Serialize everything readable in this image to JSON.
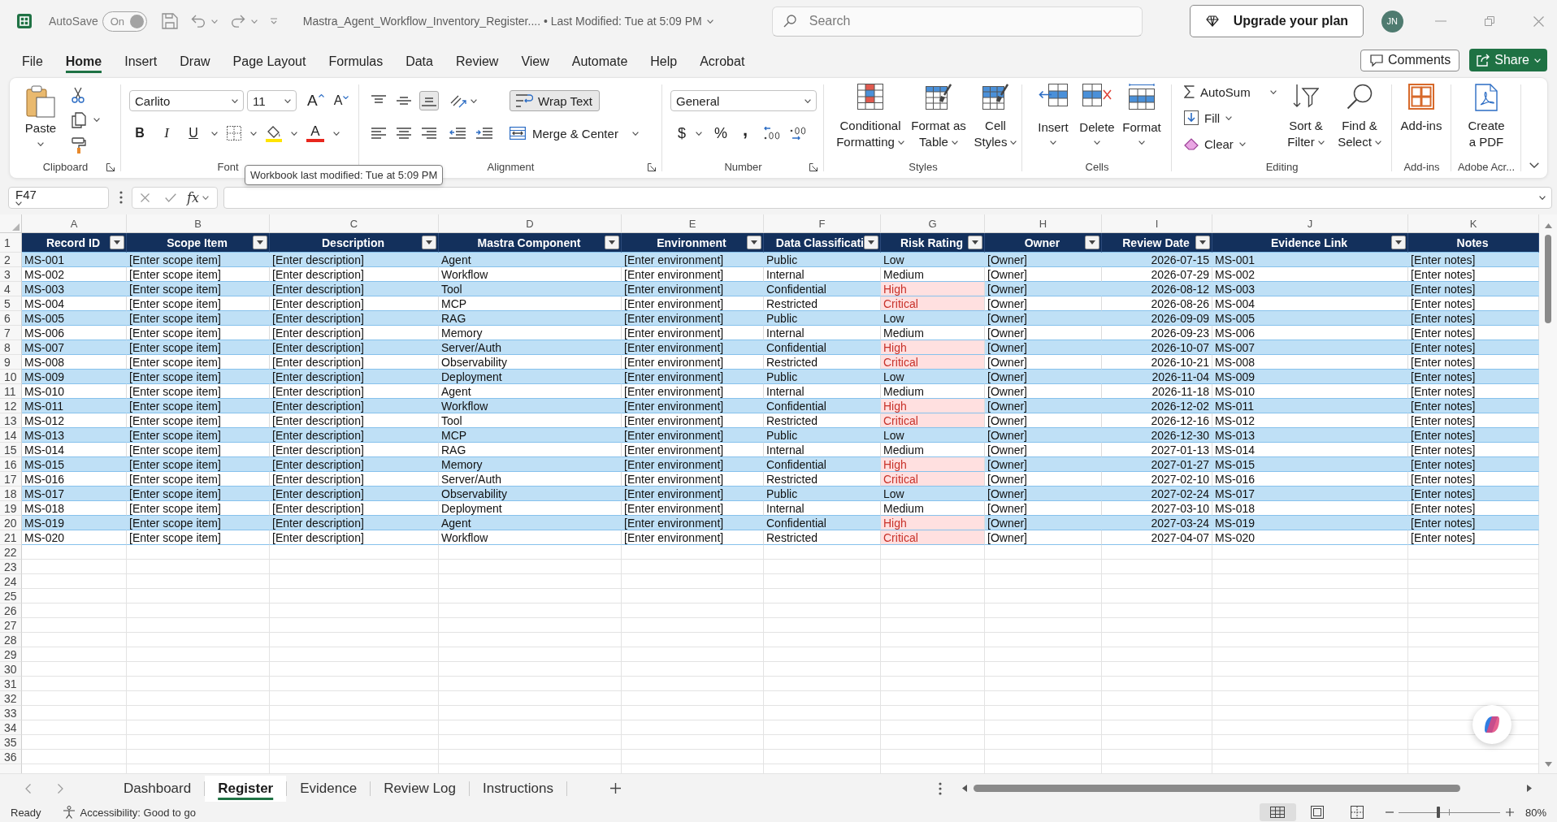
{
  "title_bar": {
    "autosave": {
      "label": "AutoSave",
      "state": "On",
      "on": true,
      "disabled": true
    },
    "title": "Mastra_Agent_Workflow_Inventory_Register.... • Last Modified: Tue at 5:09 PM",
    "search": {
      "placeholder": "Search"
    },
    "upgrade_button": "Upgrade your plan",
    "avatar": "JN"
  },
  "menu": {
    "tabs": [
      {
        "label": "File",
        "selected": false
      },
      {
        "label": "Home",
        "selected": true
      },
      {
        "label": "Insert",
        "selected": false
      },
      {
        "label": "Draw",
        "selected": false
      },
      {
        "label": "Page Layout",
        "selected": false
      },
      {
        "label": "Formulas",
        "selected": false
      },
      {
        "label": "Data",
        "selected": false
      },
      {
        "label": "Review",
        "selected": false
      },
      {
        "label": "View",
        "selected": false
      },
      {
        "label": "Automate",
        "selected": false
      },
      {
        "label": "Help",
        "selected": false
      },
      {
        "label": "Acrobat",
        "selected": false
      }
    ],
    "comments_button": "Comments",
    "share_button": "Share"
  },
  "ribbon": {
    "clipboard": {
      "label": "Clipboard",
      "paste": "Paste"
    },
    "font": {
      "label": "Font",
      "font_name": "Carlito",
      "font_size": "11",
      "grow_font": "A",
      "shrink_font": "A",
      "bold": "B",
      "italic": "I",
      "underline": "U",
      "font_color": "A"
    },
    "alignment": {
      "label": "Alignment",
      "vertical_align": [
        {
          "selected": false
        },
        {
          "selected": false
        },
        {
          "selected": true
        }
      ],
      "wrap_text": {
        "label": "Wrap Text",
        "selected": true
      },
      "merge": "Merge & Center"
    },
    "number": {
      "label": "Number",
      "format": "General",
      "currency": "$",
      "percent": "%",
      "comma": ","
    },
    "styles": {
      "label": "Styles",
      "buttons": [
        "Conditional Formatting",
        "Format as Table",
        "Cell Styles"
      ]
    },
    "cells": {
      "label": "Cells",
      "buttons": [
        "Insert",
        "Delete",
        "Format"
      ]
    },
    "editing": {
      "label": "Editing",
      "autosum": "AutoSum",
      "fill": "Fill",
      "clear": "Clear",
      "sort_filter": "Sort & Filter",
      "find_select": "Find & Select"
    },
    "add_ins": {
      "label": "Add-ins",
      "button": "Add-ins"
    },
    "acrobat": {
      "label": "Adobe Acr...",
      "button": "Create a PDF"
    }
  },
  "tooltip": "Workbook last modified: Tue at 5:09 PM",
  "formula_bar": {
    "name_box": "F47",
    "function_button": "fx"
  },
  "sheet": {
    "column_letters": [
      "A",
      "B",
      "C",
      "D",
      "E",
      "F",
      "G",
      "H",
      "I",
      "J",
      "K"
    ],
    "row_numbers": [
      "1",
      "2",
      "3",
      "4",
      "5",
      "6",
      "7",
      "8",
      "9",
      "10",
      "11",
      "12",
      "13",
      "14",
      "15",
      "16",
      "17",
      "18",
      "19",
      "20",
      "21",
      "22",
      "23",
      "24",
      "25",
      "26",
      "27",
      "28",
      "29",
      "30",
      "31",
      "32",
      "33",
      "34",
      "35",
      "36"
    ],
    "columns": [
      {
        "label": "Record ID",
        "filter": true,
        "kind": "text"
      },
      {
        "label": "Scope Item",
        "filter": true,
        "kind": "text"
      },
      {
        "label": "Description",
        "filter": true,
        "kind": "text"
      },
      {
        "label": "Mastra Component",
        "filter": true,
        "kind": "text"
      },
      {
        "label": "Environment",
        "filter": true,
        "kind": "text"
      },
      {
        "label": "Data Classificati",
        "filter": true,
        "kind": "text"
      },
      {
        "label": "Risk Rating",
        "filter": true,
        "kind": "rating"
      },
      {
        "label": "Owner",
        "filter": true,
        "kind": "text"
      },
      {
        "label": "Review Date",
        "filter": true,
        "kind": "date"
      },
      {
        "label": "Evidence Link",
        "filter": true,
        "kind": "text"
      },
      {
        "label": "Notes",
        "filter": false,
        "kind": "text"
      }
    ],
    "rows": [
      {
        "cells": [
          "MS-001",
          "[Enter scope item]",
          "[Enter description]",
          "Agent",
          "[Enter environment]",
          "Public",
          "Low",
          "[Owner]",
          "2026-07-15",
          "MS-001",
          "[Enter notes]"
        ],
        "flagged": false
      },
      {
        "cells": [
          "MS-002",
          "[Enter scope item]",
          "[Enter description]",
          "Workflow",
          "[Enter environment]",
          "Internal",
          "Medium",
          "[Owner]",
          "2026-07-29",
          "MS-002",
          "[Enter notes]"
        ],
        "flagged": false
      },
      {
        "cells": [
          "MS-003",
          "[Enter scope item]",
          "[Enter description]",
          "Tool",
          "[Enter environment]",
          "Confidential",
          "High",
          "[Owner]",
          "2026-08-12",
          "MS-003",
          "[Enter notes]"
        ],
        "flagged": true
      },
      {
        "cells": [
          "MS-004",
          "[Enter scope item]",
          "[Enter description]",
          "MCP",
          "[Enter environment]",
          "Restricted",
          "Critical",
          "[Owner]",
          "2026-08-26",
          "MS-004",
          "[Enter notes]"
        ],
        "flagged": true
      },
      {
        "cells": [
          "MS-005",
          "[Enter scope item]",
          "[Enter description]",
          "RAG",
          "[Enter environment]",
          "Public",
          "Low",
          "[Owner]",
          "2026-09-09",
          "MS-005",
          "[Enter notes]"
        ],
        "flagged": false
      },
      {
        "cells": [
          "MS-006",
          "[Enter scope item]",
          "[Enter description]",
          "Memory",
          "[Enter environment]",
          "Internal",
          "Medium",
          "[Owner]",
          "2026-09-23",
          "MS-006",
          "[Enter notes]"
        ],
        "flagged": false
      },
      {
        "cells": [
          "MS-007",
          "[Enter scope item]",
          "[Enter description]",
          "Server/Auth",
          "[Enter environment]",
          "Confidential",
          "High",
          "[Owner]",
          "2026-10-07",
          "MS-007",
          "[Enter notes]"
        ],
        "flagged": true
      },
      {
        "cells": [
          "MS-008",
          "[Enter scope item]",
          "[Enter description]",
          "Observability",
          "[Enter environment]",
          "Restricted",
          "Critical",
          "[Owner]",
          "2026-10-21",
          "MS-008",
          "[Enter notes]"
        ],
        "flagged": true
      },
      {
        "cells": [
          "MS-009",
          "[Enter scope item]",
          "[Enter description]",
          "Deployment",
          "[Enter environment]",
          "Public",
          "Low",
          "[Owner]",
          "2026-11-04",
          "MS-009",
          "[Enter notes]"
        ],
        "flagged": false
      },
      {
        "cells": [
          "MS-010",
          "[Enter scope item]",
          "[Enter description]",
          "Agent",
          "[Enter environment]",
          "Internal",
          "Medium",
          "[Owner]",
          "2026-11-18",
          "MS-010",
          "[Enter notes]"
        ],
        "flagged": false
      },
      {
        "cells": [
          "MS-011",
          "[Enter scope item]",
          "[Enter description]",
          "Workflow",
          "[Enter environment]",
          "Confidential",
          "High",
          "[Owner]",
          "2026-12-02",
          "MS-011",
          "[Enter notes]"
        ],
        "flagged": true
      },
      {
        "cells": [
          "MS-012",
          "[Enter scope item]",
          "[Enter description]",
          "Tool",
          "[Enter environment]",
          "Restricted",
          "Critical",
          "[Owner]",
          "2026-12-16",
          "MS-012",
          "[Enter notes]"
        ],
        "flagged": true
      },
      {
        "cells": [
          "MS-013",
          "[Enter scope item]",
          "[Enter description]",
          "MCP",
          "[Enter environment]",
          "Public",
          "Low",
          "[Owner]",
          "2026-12-30",
          "MS-013",
          "[Enter notes]"
        ],
        "flagged": false
      },
      {
        "cells": [
          "MS-014",
          "[Enter scope item]",
          "[Enter description]",
          "RAG",
          "[Enter environment]",
          "Internal",
          "Medium",
          "[Owner]",
          "2027-01-13",
          "MS-014",
          "[Enter notes]"
        ],
        "flagged": false
      },
      {
        "cells": [
          "MS-015",
          "[Enter scope item]",
          "[Enter description]",
          "Memory",
          "[Enter environment]",
          "Confidential",
          "High",
          "[Owner]",
          "2027-01-27",
          "MS-015",
          "[Enter notes]"
        ],
        "flagged": true
      },
      {
        "cells": [
          "MS-016",
          "[Enter scope item]",
          "[Enter description]",
          "Server/Auth",
          "[Enter environment]",
          "Restricted",
          "Critical",
          "[Owner]",
          "2027-02-10",
          "MS-016",
          "[Enter notes]"
        ],
        "flagged": true
      },
      {
        "cells": [
          "MS-017",
          "[Enter scope item]",
          "[Enter description]",
          "Observability",
          "[Enter environment]",
          "Public",
          "Low",
          "[Owner]",
          "2027-02-24",
          "MS-017",
          "[Enter notes]"
        ],
        "flagged": false
      },
      {
        "cells": [
          "MS-018",
          "[Enter scope item]",
          "[Enter description]",
          "Deployment",
          "[Enter environment]",
          "Internal",
          "Medium",
          "[Owner]",
          "2027-03-10",
          "MS-018",
          "[Enter notes]"
        ],
        "flagged": false
      },
      {
        "cells": [
          "MS-019",
          "[Enter scope item]",
          "[Enter description]",
          "Agent",
          "[Enter environment]",
          "Confidential",
          "High",
          "[Owner]",
          "2027-03-24",
          "MS-019",
          "[Enter notes]"
        ],
        "flagged": true
      },
      {
        "cells": [
          "MS-020",
          "[Enter scope item]",
          "[Enter description]",
          "Workflow",
          "[Enter environment]",
          "Restricted",
          "Critical",
          "[Owner]",
          "2027-04-07",
          "MS-020",
          "[Enter notes]"
        ],
        "flagged": true
      }
    ]
  },
  "sheet_tabs": [
    {
      "label": "Dashboard",
      "selected": false
    },
    {
      "label": "Register",
      "selected": true
    },
    {
      "label": "Evidence",
      "selected": false
    },
    {
      "label": "Review Log",
      "selected": false
    },
    {
      "label": "Instructions",
      "selected": false
    }
  ],
  "status_bar": {
    "mode": "Ready",
    "accessibility": "Accessibility: Good to go",
    "views": [
      {
        "selected": true
      },
      {
        "selected": false
      },
      {
        "selected": false
      }
    ],
    "zoom": {
      "level": 0.39,
      "reading": "80%"
    }
  }
}
